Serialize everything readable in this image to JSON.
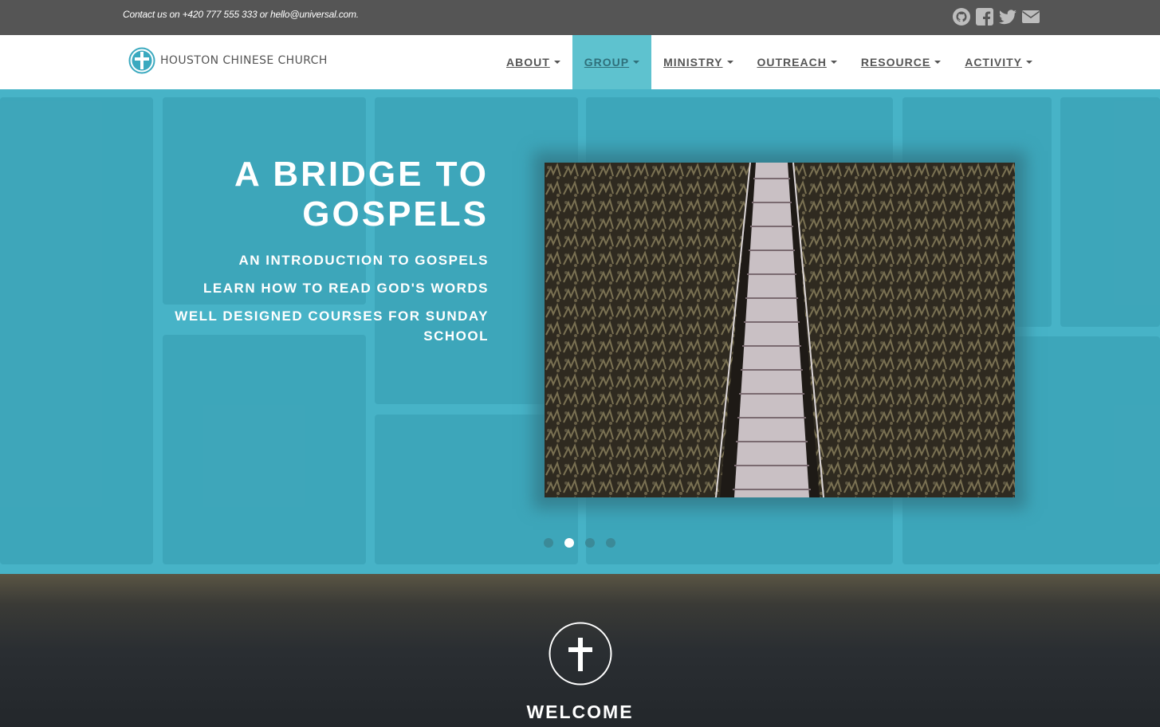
{
  "topbar": {
    "contact": "Contact us on +420 777 555 333 or hello@universal.com.",
    "socials": [
      "github-icon",
      "facebook-icon",
      "twitter-icon",
      "envelope-icon"
    ]
  },
  "brand": {
    "name": "HOUSTON CHINESE CHURCH"
  },
  "nav": {
    "items": [
      {
        "label": "ABOUT"
      },
      {
        "label": "GROUP"
      },
      {
        "label": "MINISTRY"
      },
      {
        "label": "OUTREACH"
      },
      {
        "label": "RESOURCE"
      },
      {
        "label": "ACTIVITY"
      }
    ],
    "active": "GROUP"
  },
  "hero": {
    "title_line1": "A BRIDGE TO",
    "title_line2": "GOSPELS",
    "lines": [
      "AN INTRODUCTION TO GOSPELS",
      "LEARN HOW TO READ GOD'S WORDS",
      "WELL DESIGNED COURSES FOR SUNDAY SCHOOL"
    ],
    "slides_total": 4,
    "active_slide": 2
  },
  "welcome": {
    "title": "WELCOME"
  },
  "colors": {
    "accent": "#5ec2cf",
    "topbar": "#555555",
    "hero": "#45b0c4"
  }
}
